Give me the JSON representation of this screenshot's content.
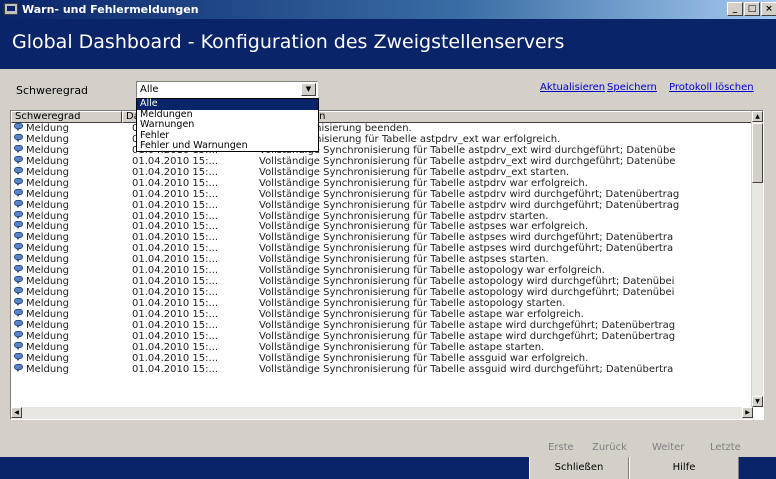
{
  "window": {
    "title": "Warn- und Fehlermeldungen",
    "min": "_",
    "max": "□",
    "close": "×"
  },
  "header": {
    "title": "Global Dashboard - Konfiguration des Zweigstellenservers"
  },
  "filter": {
    "label": "Schweregrad",
    "selected": "Alle",
    "options": [
      "Alle",
      "Meldungen",
      "Warnungen",
      "Fehler",
      "Fehler und Warnungen"
    ]
  },
  "links": {
    "refresh": "Aktualisieren",
    "save": "Speichern",
    "clear_log": "Protokoll löschen"
  },
  "table": {
    "columns": [
      "Schweregrad",
      "Da",
      "en"
    ],
    "rows": [
      [
        "Meldung",
        "0",
        "ge Synchronisierung beenden."
      ],
      [
        "Meldung",
        "0",
        "ge Synchronisierung für Tabelle astpdrv_ext war erfolgreich."
      ],
      [
        "Meldung",
        "01.04.2010 15:...",
        "Vollständige Synchronisierung für Tabelle astpdrv_ext wird durchgeführt; Datenübe"
      ],
      [
        "Meldung",
        "01.04.2010 15:...",
        "Vollständige Synchronisierung für Tabelle astpdrv_ext wird durchgeführt; Datenübe"
      ],
      [
        "Meldung",
        "01.04.2010 15:...",
        "Vollständige Synchronisierung für Tabelle astpdrv_ext starten."
      ],
      [
        "Meldung",
        "01.04.2010 15:...",
        "Vollständige Synchronisierung für Tabelle astpdrv war erfolgreich."
      ],
      [
        "Meldung",
        "01.04.2010 15:...",
        "Vollständige Synchronisierung für Tabelle astpdrv wird durchgeführt; Datenübertrag"
      ],
      [
        "Meldung",
        "01.04.2010 15:...",
        "Vollständige Synchronisierung für Tabelle astpdrv wird durchgeführt; Datenübertrag"
      ],
      [
        "Meldung",
        "01.04.2010 15:...",
        "Vollständige Synchronisierung für Tabelle astpdrv starten."
      ],
      [
        "Meldung",
        "01.04.2010 15:...",
        "Vollständige Synchronisierung für Tabelle astpses war erfolgreich."
      ],
      [
        "Meldung",
        "01.04.2010 15:...",
        "Vollständige Synchronisierung für Tabelle astpses wird durchgeführt; Datenübertra"
      ],
      [
        "Meldung",
        "01.04.2010 15:...",
        "Vollständige Synchronisierung für Tabelle astpses wird durchgeführt; Datenübertra"
      ],
      [
        "Meldung",
        "01.04.2010 15:...",
        "Vollständige Synchronisierung für Tabelle astpses starten."
      ],
      [
        "Meldung",
        "01.04.2010 15:...",
        "Vollständige Synchronisierung für Tabelle astopology war erfolgreich."
      ],
      [
        "Meldung",
        "01.04.2010 15:...",
        "Vollständige Synchronisierung für Tabelle astopology wird durchgeführt; Datenübei"
      ],
      [
        "Meldung",
        "01.04.2010 15:...",
        "Vollständige Synchronisierung für Tabelle astopology wird durchgeführt; Datenübei"
      ],
      [
        "Meldung",
        "01.04.2010 15:...",
        "Vollständige Synchronisierung für Tabelle astopology starten."
      ],
      [
        "Meldung",
        "01.04.2010 15:...",
        "Vollständige Synchronisierung für Tabelle astape war erfolgreich."
      ],
      [
        "Meldung",
        "01.04.2010 15:...",
        "Vollständige Synchronisierung für Tabelle astape wird durchgeführt; Datenübertrag"
      ],
      [
        "Meldung",
        "01.04.2010 15:...",
        "Vollständige Synchronisierung für Tabelle astape wird durchgeführt; Datenübertrag"
      ],
      [
        "Meldung",
        "01.04.2010 15:...",
        "Vollständige Synchronisierung für Tabelle astape starten."
      ],
      [
        "Meldung",
        "01.04.2010 15:...",
        "Vollständige Synchronisierung für Tabelle assguid war erfolgreich."
      ],
      [
        "Meldung",
        "01.04.2010 15:...",
        "Vollständige Synchronisierung für Tabelle assguid wird durchgeführt; Datenübertra"
      ]
    ]
  },
  "pager": {
    "first": "Erste",
    "back": "Zurück",
    "next": "Weiter",
    "last": "Letzte"
  },
  "footer": {
    "close": "Schließen",
    "help": "Hilfe"
  },
  "colors": {
    "header_bg": "#0a246a",
    "link": "#0000cc",
    "selection": "#0a246a",
    "window_bg": "#d4d0c8"
  }
}
